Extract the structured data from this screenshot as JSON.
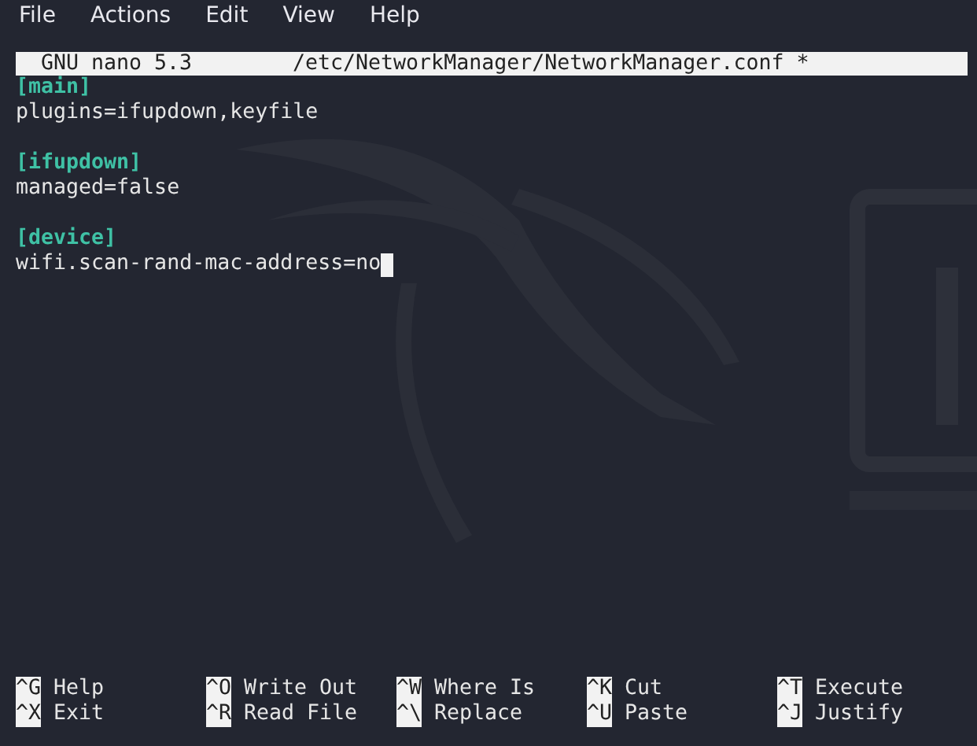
{
  "menu": [
    "File",
    "Actions",
    "Edit",
    "View",
    "Help"
  ],
  "title_bar": {
    "program": "GNU nano 5.3",
    "file": "/etc/NetworkManager/NetworkManager.conf *"
  },
  "sections": [
    {
      "header": "[main]",
      "lines": [
        {
          "text": "plugins=ifupdown,keyfile",
          "cursor": false
        }
      ]
    },
    {
      "header": "[ifupdown]",
      "lines": [
        {
          "text": "managed=false",
          "cursor": false
        }
      ]
    },
    {
      "header": "[device]",
      "lines": [
        {
          "text": "wifi.scan-rand-mac-address=no",
          "cursor": true
        }
      ]
    }
  ],
  "shortcuts": [
    [
      {
        "key": "^G",
        "label": "Help"
      },
      {
        "key": "^X",
        "label": "Exit"
      }
    ],
    [
      {
        "key": "^O",
        "label": "Write Out"
      },
      {
        "key": "^R",
        "label": "Read File"
      }
    ],
    [
      {
        "key": "^W",
        "label": "Where Is"
      },
      {
        "key": "^\\",
        "label": "Replace"
      }
    ],
    [
      {
        "key": "^K",
        "label": "Cut"
      },
      {
        "key": "^U",
        "label": "Paste"
      }
    ],
    [
      {
        "key": "^T",
        "label": "Execute"
      },
      {
        "key": "^J",
        "label": "Justify"
      }
    ]
  ]
}
